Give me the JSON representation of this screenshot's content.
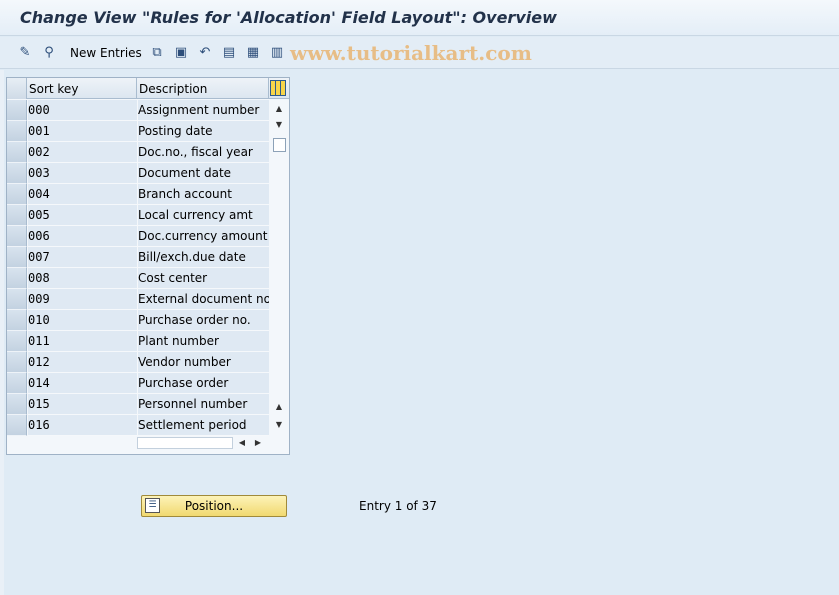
{
  "window": {
    "title": "Change View \"Rules for 'Allocation' Field Layout\": Overview"
  },
  "toolbar": {
    "icons": [
      {
        "name": "change-display-icon",
        "glyph": "✎"
      },
      {
        "name": "find-icon",
        "glyph": "⚲"
      },
      {
        "name": "copy-as-icon",
        "glyph": "⧉"
      },
      {
        "name": "delete-icon",
        "glyph": "▣"
      },
      {
        "name": "undo-change-icon",
        "glyph": "↶"
      },
      {
        "name": "select-all-icon",
        "glyph": "▤"
      },
      {
        "name": "select-block-icon",
        "glyph": "▦"
      },
      {
        "name": "deselect-all-icon",
        "glyph": "▥"
      }
    ],
    "new_entries_label": "New Entries",
    "watermark": "www.tutorialkart.com"
  },
  "table": {
    "columns": [
      "Sort key",
      "Description"
    ],
    "rows": [
      {
        "key": "000",
        "desc": "Assignment number"
      },
      {
        "key": "001",
        "desc": "Posting date"
      },
      {
        "key": "002",
        "desc": "Doc.no., fiscal year"
      },
      {
        "key": "003",
        "desc": "Document date"
      },
      {
        "key": "004",
        "desc": "Branch account"
      },
      {
        "key": "005",
        "desc": "Local currency amt"
      },
      {
        "key": "006",
        "desc": "Doc.currency amount"
      },
      {
        "key": "007",
        "desc": "Bill/exch.due date"
      },
      {
        "key": "008",
        "desc": "Cost center"
      },
      {
        "key": "009",
        "desc": "External document no"
      },
      {
        "key": "010",
        "desc": "Purchase order no."
      },
      {
        "key": "011",
        "desc": "Plant number"
      },
      {
        "key": "012",
        "desc": "Vendor number"
      },
      {
        "key": "014",
        "desc": "Purchase order"
      },
      {
        "key": "015",
        "desc": "Personnel number"
      },
      {
        "key": "016",
        "desc": "Settlement period"
      }
    ]
  },
  "footer": {
    "position_button_label": "Position...",
    "entry_info": "Entry 1 of 37"
  }
}
